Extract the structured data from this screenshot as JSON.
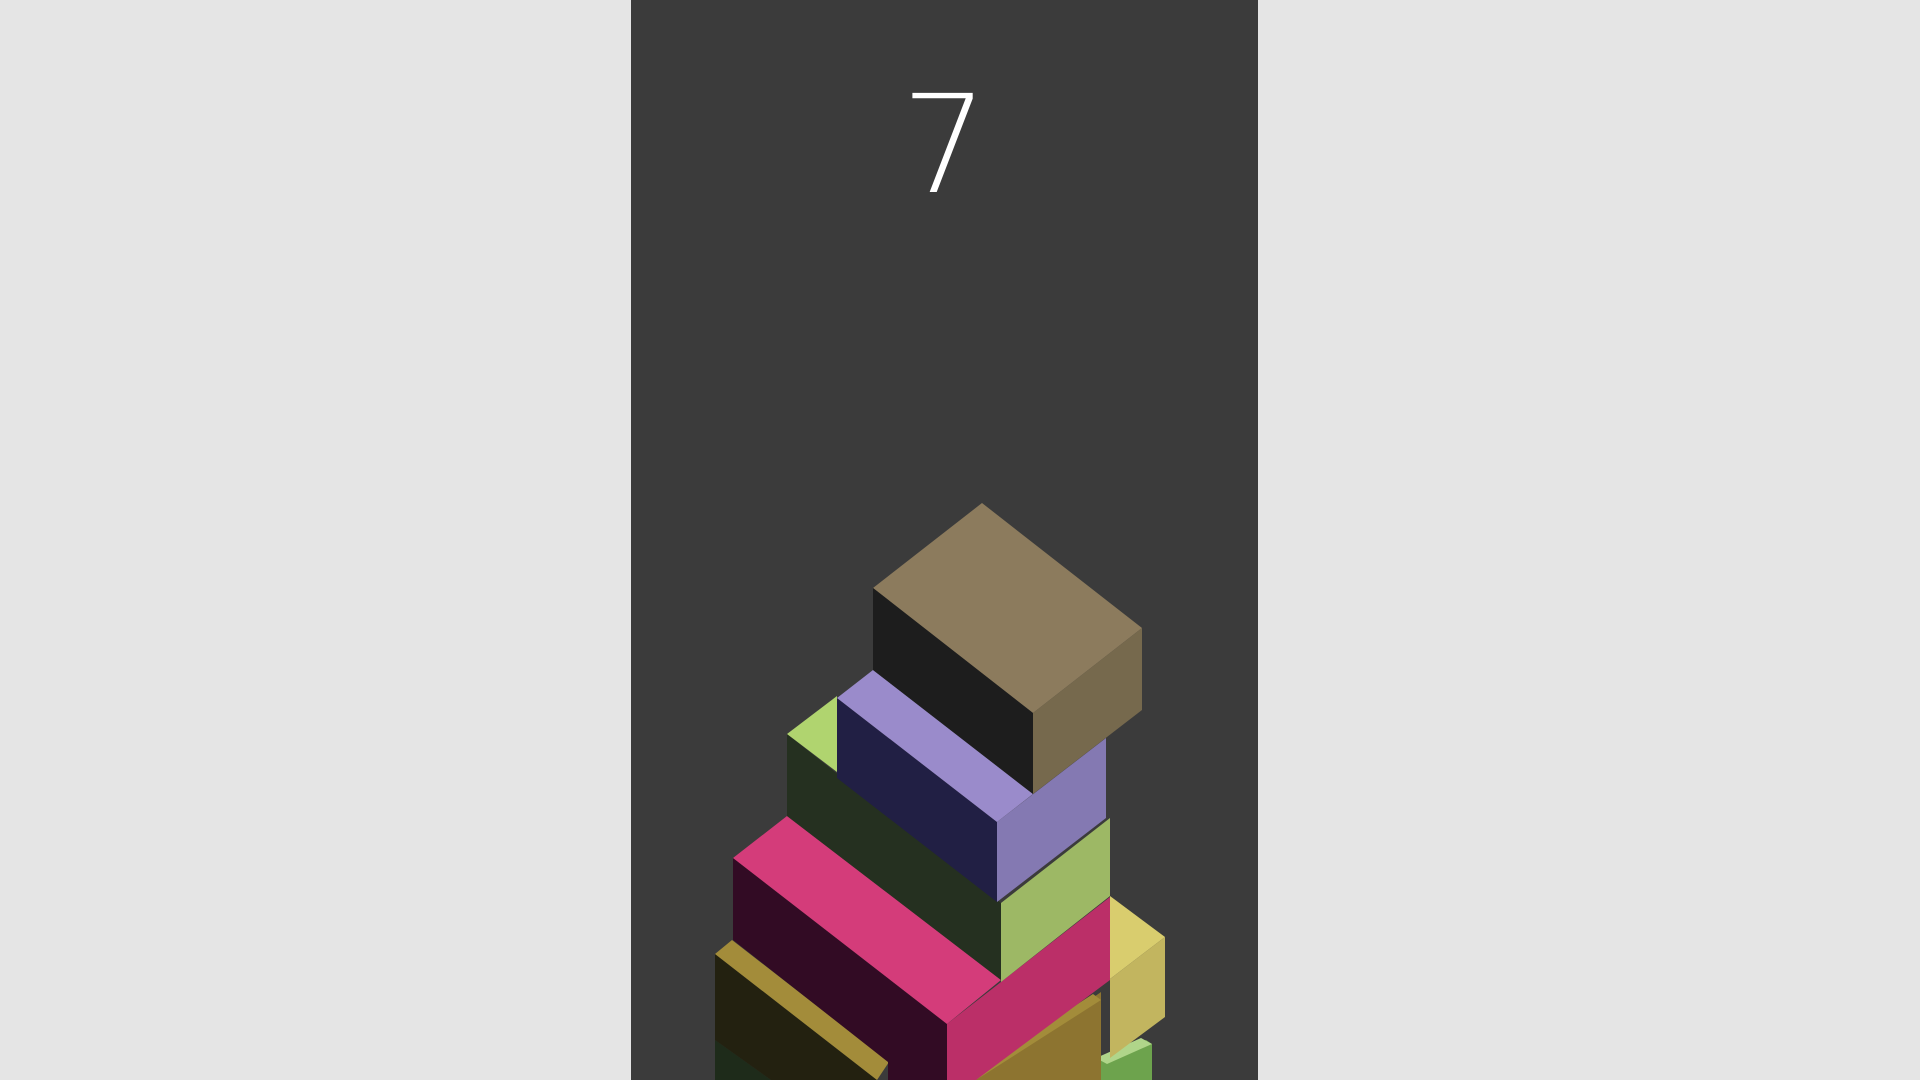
{
  "game": {
    "score": "7"
  },
  "colors": {
    "background": "#e5e5e5",
    "panel": "#3b3b3b",
    "score_text": "#ffffff"
  },
  "stack": {
    "block_count": 7,
    "blocks": [
      {
        "name": "block-green-base",
        "top": "#b0d58a",
        "front": "#1e2b1a",
        "side": "#6da34d"
      },
      {
        "name": "block-olive",
        "top": "#a38c3a",
        "front": "#232110",
        "side": "#8d7430"
      },
      {
        "name": "block-yellow",
        "top": "#d9cd6e",
        "front": "#2a2a14",
        "side": "#c2b55f"
      },
      {
        "name": "block-pink",
        "top": "#d43c7a",
        "front": "#320b24",
        "side": "#bb2f68"
      },
      {
        "name": "block-lime",
        "top": "#b0d46f",
        "front": "#253020",
        "side": "#9db865"
      },
      {
        "name": "block-lavender",
        "top": "#9a8bcb",
        "front": "#211f44",
        "side": "#8479b2"
      },
      {
        "name": "block-taupe-active",
        "top": "#8c7b5d",
        "front": "#1d1d1d",
        "side": "#76694d"
      }
    ]
  }
}
